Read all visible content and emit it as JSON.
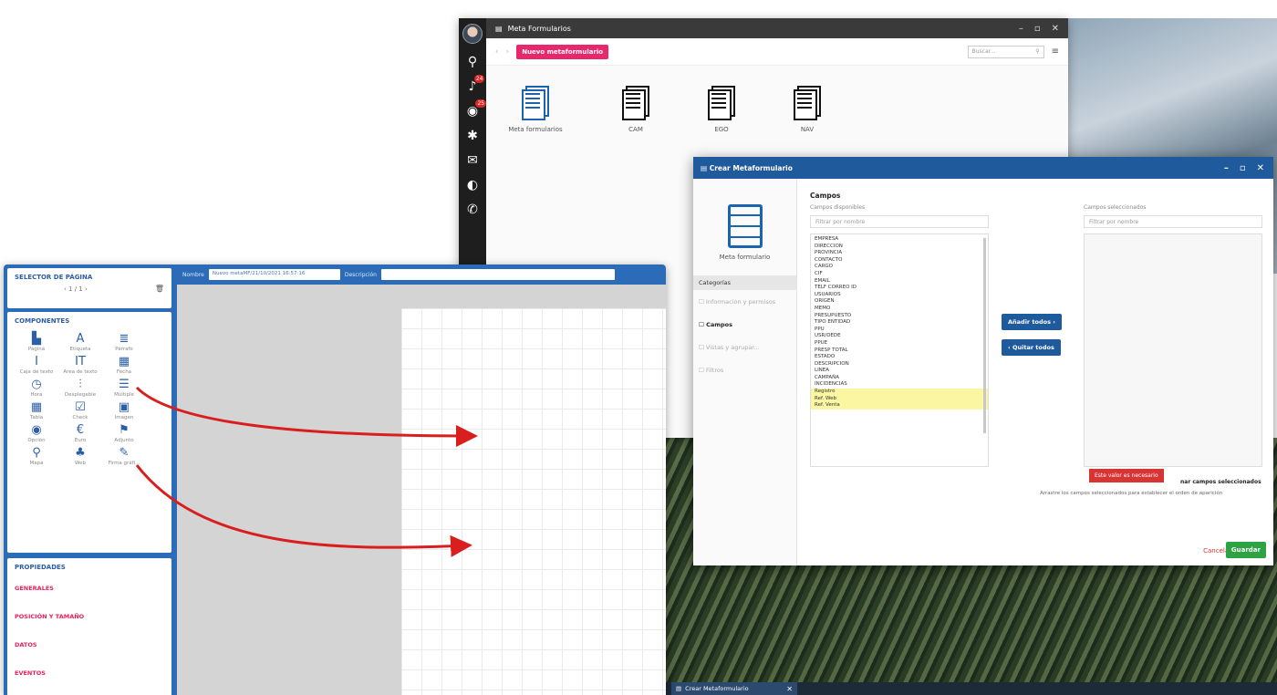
{
  "meta_window": {
    "title": "Meta Formularios",
    "new_button": "Nuevo metaformulario",
    "search_placeholder": "Buscar...",
    "badges": [
      "24",
      "25"
    ],
    "folders": [
      {
        "label": "Meta formularios"
      },
      {
        "label": "CAM"
      },
      {
        "label": "EGO"
      },
      {
        "label": "NAV"
      }
    ]
  },
  "dialog": {
    "title": "Crear Metaformulario",
    "icon_caption": "Meta formulario",
    "categories_title": "Categorías",
    "categories": [
      {
        "label": "Informacion y permisos"
      },
      {
        "label": "Campos"
      },
      {
        "label": "Vistas y agrupar..."
      },
      {
        "label": "Filtros"
      }
    ],
    "campos_title": "Campos",
    "available_label": "Campos disponibles",
    "selected_label": "Campos seleccionados",
    "filter_placeholder": "Filtrar por nombre",
    "available_fields": [
      "EMPRESA",
      "DIRECCION",
      "PROVINCIA",
      "CONTACTO",
      "CARGO",
      "CIF",
      "EMAIL",
      "TELF CORREO ID",
      "USUARIOS",
      "ORIGEN",
      "MEMO",
      "PRESUPUESTO",
      "TIPO ENTIDAD",
      "PPU",
      "USR/DEDE",
      "PPUE",
      "PRESP TOTAL",
      "ESTADO",
      "DESCRIPCION",
      "LINEA",
      "CAMPAÑA",
      "INCIDENCIAS",
      "Registro",
      "Ref. Web",
      "Ref. Venta"
    ],
    "add_all": "Añadir todos",
    "remove_all": "Quitar todos",
    "tooltip": "Este valor es necesario",
    "hint_bold": "nar campos seleccionados",
    "hint_text": "Arrastre los campos seleccionados para establecer el orden de aparición",
    "cancel": "Cancelar",
    "save": "Guardar"
  },
  "taskbar": {
    "tab_label": "Crear Metaformulario"
  },
  "designer": {
    "page_selector_title": "SELECTOR DE PÁGINA",
    "pager": "‹ 1 / 1 ›",
    "components_title": "COMPONENTES",
    "components": [
      {
        "label": "Página",
        "icon": "page-icon",
        "glyph": "▙"
      },
      {
        "label": "Etiqueta",
        "icon": "label-icon",
        "glyph": "A"
      },
      {
        "label": "Párrafo",
        "icon": "paragraph-icon",
        "glyph": "≣"
      },
      {
        "label": "Caja de texto",
        "icon": "textbox-icon",
        "glyph": "I"
      },
      {
        "label": "Área de texto",
        "icon": "textarea-icon",
        "glyph": "IT"
      },
      {
        "label": "Fecha",
        "icon": "calendar-icon",
        "glyph": "▦"
      },
      {
        "label": "Hora",
        "icon": "clock-icon",
        "glyph": "◷"
      },
      {
        "label": "Desplegable",
        "icon": "dropdown-icon",
        "glyph": "⫶"
      },
      {
        "label": "Múltiple",
        "icon": "list-icon",
        "glyph": "☰"
      },
      {
        "label": "Tabla",
        "icon": "table-icon",
        "glyph": "▦"
      },
      {
        "label": "Check",
        "icon": "check-icon",
        "glyph": "☑"
      },
      {
        "label": "Imagen",
        "icon": "image-icon",
        "glyph": "▣"
      },
      {
        "label": "Opción",
        "icon": "radio-icon",
        "glyph": "◉"
      },
      {
        "label": "Euro",
        "icon": "euro-icon",
        "glyph": "€"
      },
      {
        "label": "Adjunto",
        "icon": "attachment-icon",
        "glyph": "⚑"
      },
      {
        "label": "Mapa",
        "icon": "map-pin-icon",
        "glyph": "⚲"
      },
      {
        "label": "Web",
        "icon": "web-icon",
        "glyph": "♣"
      },
      {
        "label": "Firma gráfi...",
        "icon": "pen-icon",
        "glyph": "✎"
      }
    ],
    "properties_title": "PROPIEDADES",
    "properties": [
      "GENERALES",
      "POSICIÓN Y TAMAÑO",
      "DATOS",
      "EVENTOS"
    ],
    "top_name_label": "Nombre",
    "top_name_value": "Nuevo metaMF/21/10/2021 16:57:16",
    "top_desc_label": "Descripción",
    "top_desc_value": ""
  },
  "colors": {
    "accent_blue": "#1e5a9c",
    "pink": "#e8286b",
    "arrow_red": "#d91e1e",
    "save_green": "#2ea343"
  }
}
